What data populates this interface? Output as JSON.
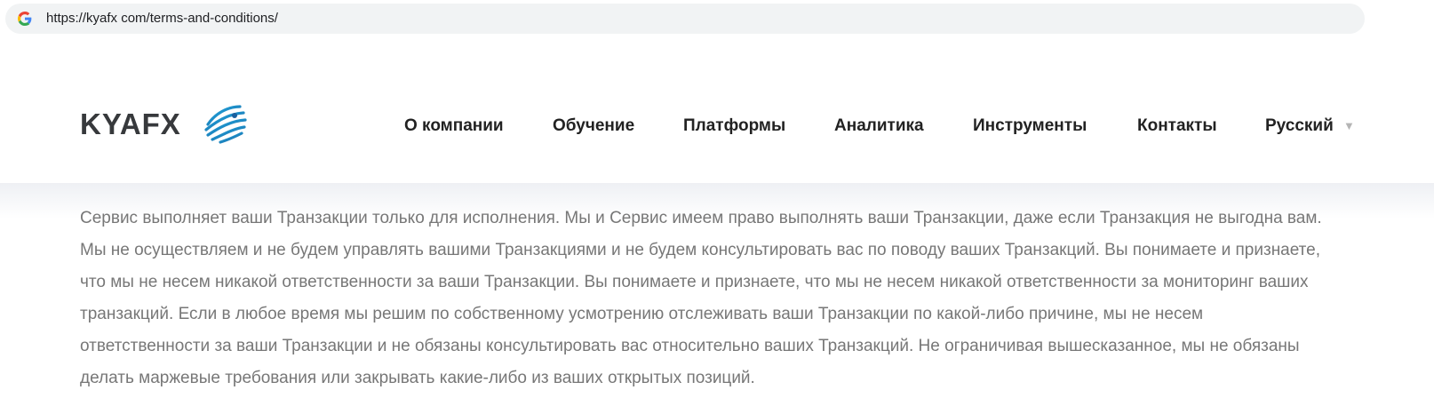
{
  "browser": {
    "url": "https://kyafx com/terms-and-conditions/",
    "favicon_icon": "google-g-icon"
  },
  "header": {
    "logo_text": "KYAFX",
    "logo_icon": "globe-swoosh-icon",
    "nav": [
      {
        "label": "О компании"
      },
      {
        "label": "Обучение"
      },
      {
        "label": "Платформы"
      },
      {
        "label": "Аналитика"
      },
      {
        "label": "Инструменты"
      },
      {
        "label": "Контакты"
      },
      {
        "label": "Русский"
      }
    ],
    "lang_caret": "▼"
  },
  "content": {
    "lines": [
      "Сервис выполняет ваши Транзакции только для исполнения. Мы и Сервис имеем право выполнять ваши Транзакции, даже если Транзакция не выгодна вам.",
      "Мы не осуществляем и не будем управлять вашими Транзакциями и не будем консультировать вас по поводу ваших Транзакций. Вы понимаете и признаете,",
      "что мы не несем никакой ответственности за ваши Транзакции. Вы понимаете и признаете, что мы не несем никакой ответственности за мониторинг ваших",
      "транзакций. Если в любое время мы решим по собственному усмотрению отслеживать ваши Транзакции по какой-либо причине, мы не несем",
      "ответственности за ваши Транзакции и не обязаны консультировать вас относительно ваших Транзакций. Не ограничивая вышесказанное, мы не обязаны",
      "делать маржевые требования или закрывать какие-либо из ваших открытых позиций."
    ]
  },
  "colors": {
    "brand_blue": "#2a93cc",
    "logo_text": "#37393c",
    "nav_text": "#222222",
    "body_text": "#777777"
  }
}
